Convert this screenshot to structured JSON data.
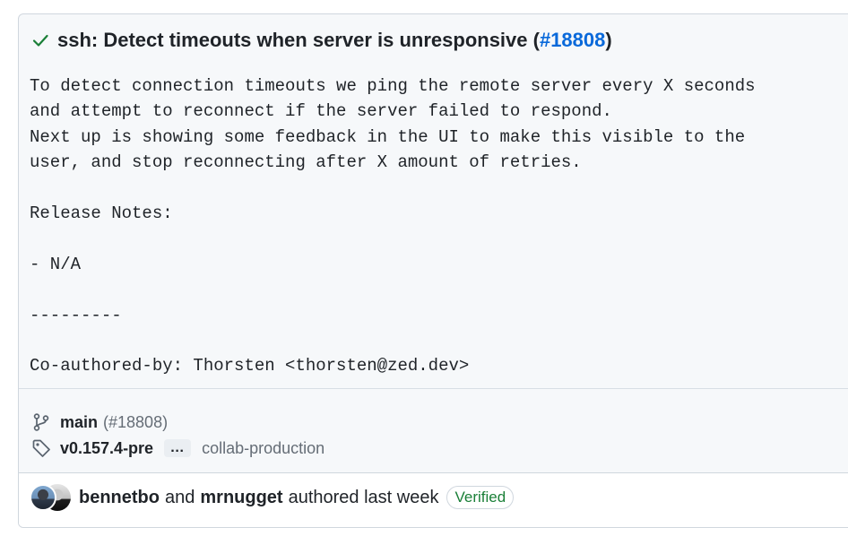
{
  "commit": {
    "title_prefix": "ssh: Detect timeouts when server is unresponsive (",
    "pr_number": "#18808",
    "title_suffix": ")",
    "status_icon": "check-icon",
    "body_lines": [
      "To detect connection timeouts we ping the remote server every X seconds",
      "and attempt to reconnect if the server failed to respond.",
      "Next up is showing some feedback in the UI to make this visible to the",
      "user, and stop reconnecting after X amount of retries.",
      "",
      "Release Notes:",
      "",
      "- N/A",
      "",
      "---------",
      "",
      "Co-authored-by: Thorsten <thorsten@zed.dev>"
    ]
  },
  "refs": {
    "branch_icon": "git-branch-icon",
    "branch": "main",
    "branch_pr": "(#18808)",
    "tag_icon": "tag-icon",
    "tag": "v0.157.4-pre",
    "ellipsis": "…",
    "other_tag": "collab-production"
  },
  "footer": {
    "author_1": "bennetbo",
    "joiner": "and",
    "author_2": "mrnugget",
    "authored_text": "authored last week",
    "verified_label": "Verified"
  },
  "colors": {
    "link": "#0969da",
    "success": "#1a7f37",
    "muted": "#656d76",
    "text": "#1f2328"
  }
}
